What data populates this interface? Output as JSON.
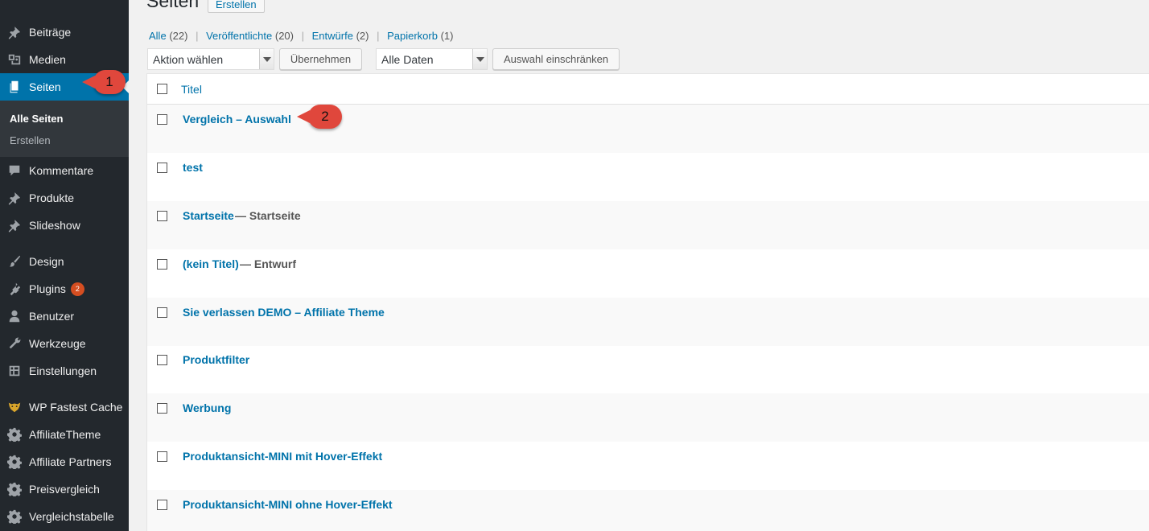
{
  "sidebar": {
    "items": [
      {
        "label": "Beiträge",
        "icon": "pin-icon"
      },
      {
        "label": "Medien",
        "icon": "media-icon"
      },
      {
        "label": "Seiten",
        "icon": "page-icon"
      },
      {
        "label": "Kommentare",
        "icon": "comment-icon"
      },
      {
        "label": "Produkte",
        "icon": "pin-icon"
      },
      {
        "label": "Slideshow",
        "icon": "pin-icon"
      },
      {
        "label": "Design",
        "icon": "brush-icon"
      },
      {
        "label": "Plugins",
        "icon": "plugin-icon",
        "badge": "2"
      },
      {
        "label": "Benutzer",
        "icon": "user-icon"
      },
      {
        "label": "Werkzeuge",
        "icon": "wrench-icon"
      },
      {
        "label": "Einstellungen",
        "icon": "settings-icon"
      },
      {
        "label": "WP Fastest Cache",
        "icon": "cheetah-icon"
      },
      {
        "label": "AffiliateTheme",
        "icon": "gear-icon"
      },
      {
        "label": "Affiliate Partners",
        "icon": "gear-icon"
      },
      {
        "label": "Preisvergleich",
        "icon": "gear-icon"
      },
      {
        "label": "Vergleichstabelle",
        "icon": "gear-icon"
      }
    ],
    "submenu": [
      "Alle Seiten",
      "Erstellen"
    ]
  },
  "callouts": [
    "1",
    "2"
  ],
  "header": {
    "title": "Seiten",
    "add_new": "Erstellen"
  },
  "filters": {
    "all": "Alle",
    "all_count": "(22)",
    "published": "Veröffentlichte",
    "published_count": "(20)",
    "drafts": "Entwürfe",
    "drafts_count": "(2)",
    "trash": "Papierkorb",
    "trash_count": "(1)",
    "sep": "|"
  },
  "toolbar": {
    "bulk_action": "Aktion wählen",
    "apply": "Übernehmen",
    "dates": "Alle Daten",
    "filter": "Auswahl einschränken"
  },
  "table": {
    "header_title": "Titel",
    "rows": [
      {
        "title": "Vergleich – Auswahl",
        "state": ""
      },
      {
        "title": "test",
        "state": ""
      },
      {
        "title": "Startseite",
        "state": " — Startseite"
      },
      {
        "title": "(kein Titel)",
        "state": " — Entwurf"
      },
      {
        "title": "Sie verlassen DEMO – Affiliate Theme",
        "state": ""
      },
      {
        "title": "Produktfilter",
        "state": ""
      },
      {
        "title": "Werbung",
        "state": ""
      },
      {
        "title": "Produktansicht-MINI mit Hover-Effekt",
        "state": ""
      },
      {
        "title": "Produktansicht-MINI ohne Hover-Effekt",
        "state": ""
      }
    ]
  },
  "colors": {
    "sidebar_bg": "#23282d",
    "active": "#0073aa",
    "link": "#0073aa",
    "callout": "#e0473c"
  }
}
